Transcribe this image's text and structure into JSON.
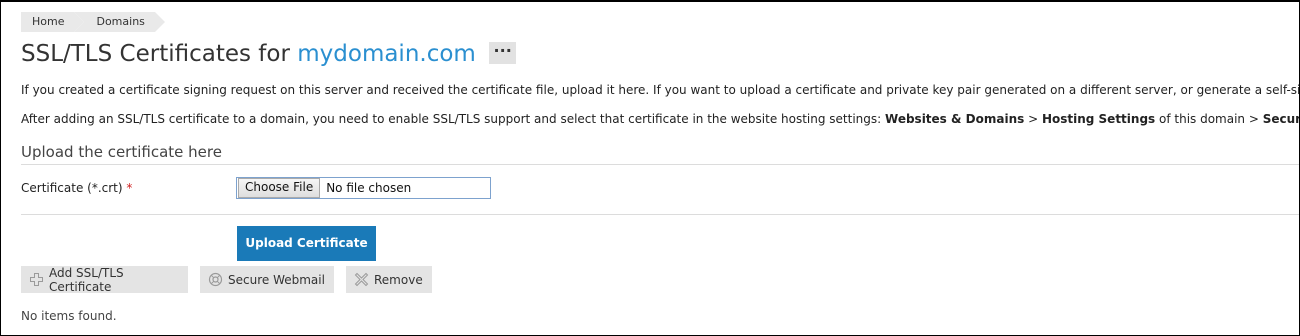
{
  "breadcrumb": {
    "items": [
      {
        "label": "Home"
      },
      {
        "label": "Domains"
      }
    ]
  },
  "header": {
    "title_prefix": "SSL/TLS Certificates for",
    "domain": "mydomain.com",
    "more_label": "···"
  },
  "description": {
    "line1": "If you created a certificate signing request on this server and received the certificate file, upload it here. If you want to upload a certificate and private key pair generated on a different server, or generate a self-sig",
    "line2_prefix": "After adding an SSL/TLS certificate to a domain, you need to enable SSL/TLS support and select that certificate in the website hosting settings: ",
    "line2_b1": "Websites & Domains",
    "line2_sep1": " > ",
    "line2_b2": "Hosting Settings",
    "line2_mid": " of this domain > ",
    "line2_b3": "Security",
    "line2_end": "."
  },
  "upload_section": {
    "title": "Upload the certificate here",
    "field_label": "Certificate (*.crt)",
    "required_mark": "*",
    "choose_file_label": "Choose File",
    "file_status": "No file chosen",
    "upload_button": "Upload Certificate"
  },
  "toolbar": {
    "add_label": "Add SSL/TLS Certificate",
    "webmail_label": "Secure Webmail",
    "remove_label": "Remove"
  },
  "list": {
    "empty_message": "No items found."
  },
  "colors": {
    "accent": "#1a7ab8",
    "link": "#2a8fd0",
    "required": "#d02020"
  },
  "icons": [
    "plus-icon",
    "webmail-icon",
    "remove-icon"
  ]
}
